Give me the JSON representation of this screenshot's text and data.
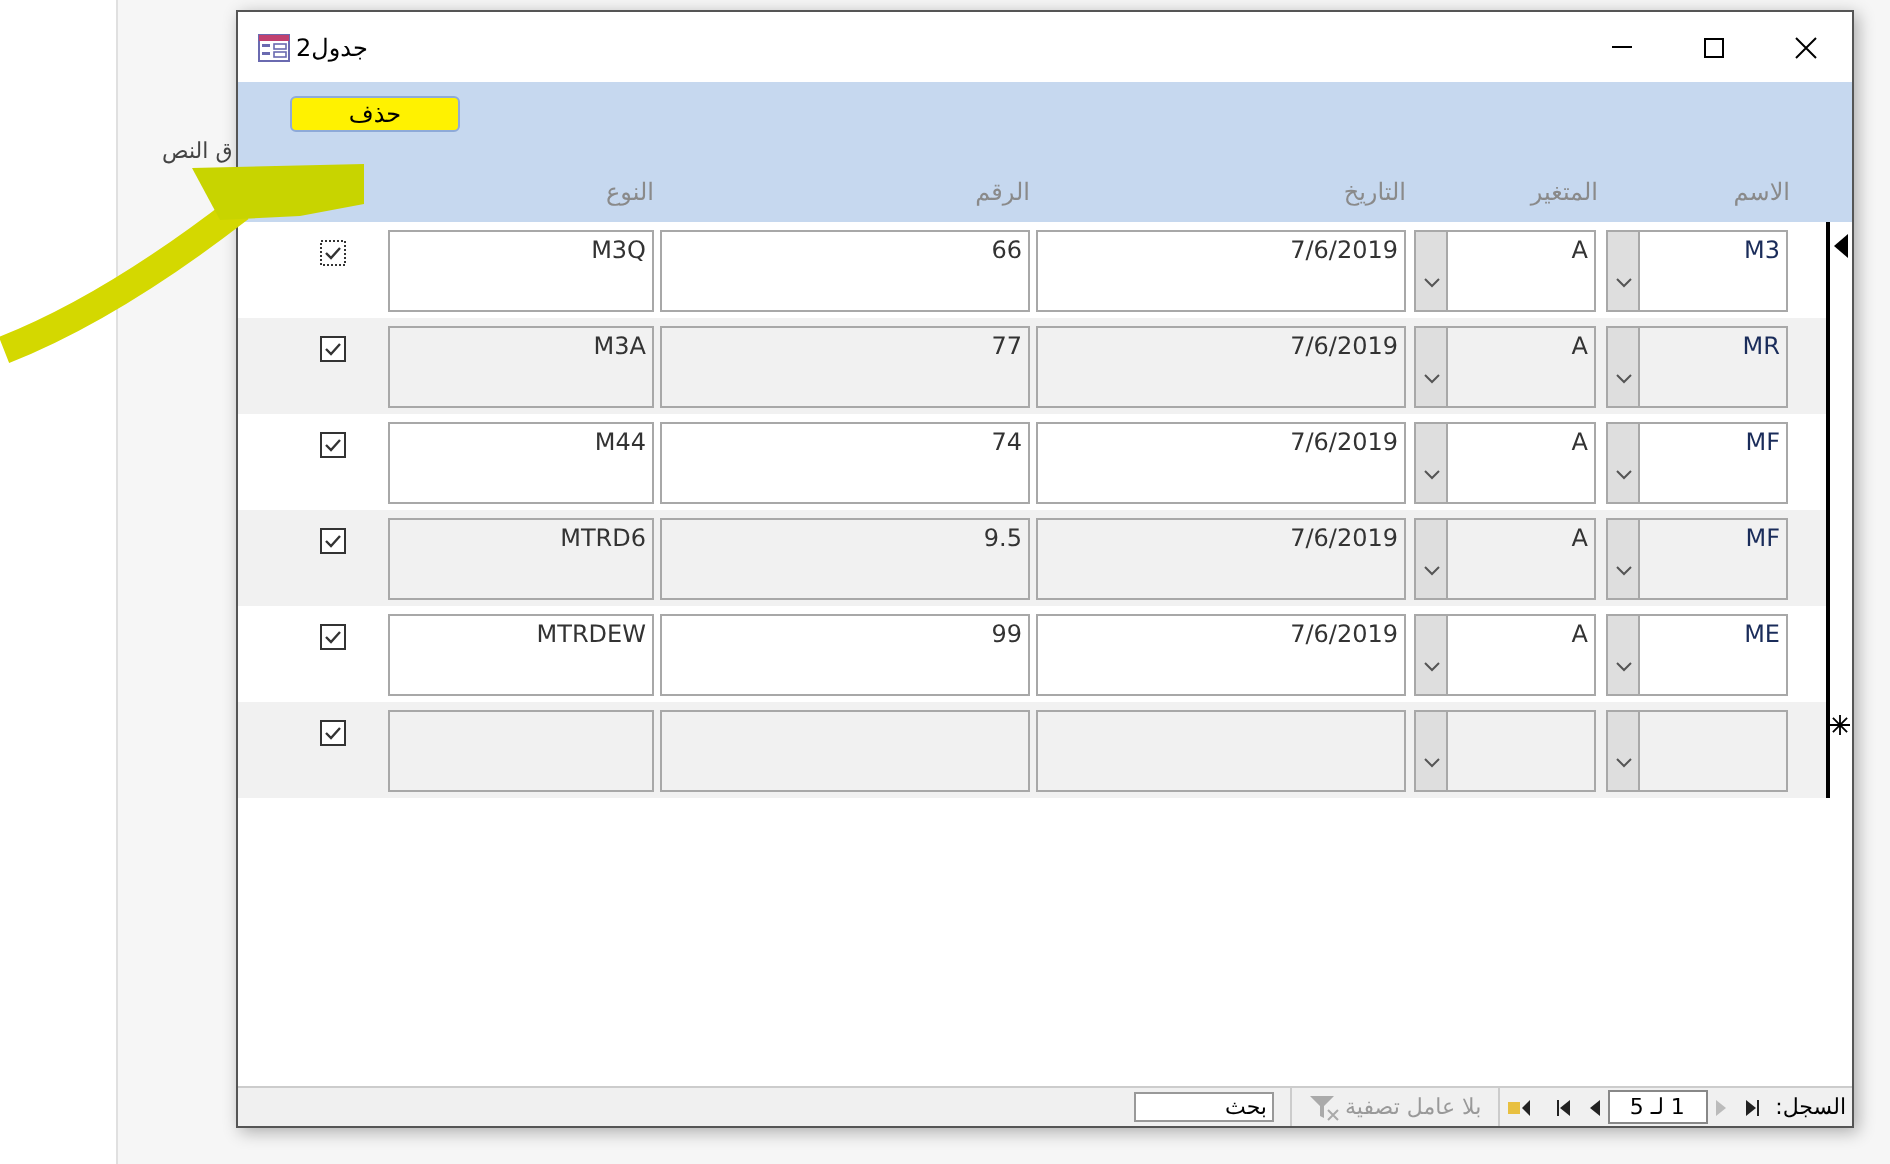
{
  "ribbon": {
    "group_label": "ق النص"
  },
  "window": {
    "title": "جدول2"
  },
  "header": {
    "delete_button": "حذف",
    "columns": [
      "الاسم",
      "المتغير",
      "التاريخ",
      "الرقم",
      "النوع"
    ]
  },
  "rows": [
    {
      "kind": "record",
      "current": true,
      "checked": true,
      "type": "M3Q",
      "number": "66",
      "date": "7/6/2019",
      "variable": "A",
      "name": "M3"
    },
    {
      "kind": "record",
      "current": false,
      "checked": true,
      "type": "M3A",
      "number": "77",
      "date": "7/6/2019",
      "variable": "A",
      "name": "MR"
    },
    {
      "kind": "record",
      "current": false,
      "checked": true,
      "type": "M44",
      "number": "74",
      "date": "7/6/2019",
      "variable": "A",
      "name": "MF"
    },
    {
      "kind": "record",
      "current": false,
      "checked": true,
      "type": "MTRD6",
      "number": "9.5",
      "date": "7/6/2019",
      "variable": "A",
      "name": "MF"
    },
    {
      "kind": "record",
      "current": false,
      "checked": true,
      "type": "MTRDEW",
      "number": "99",
      "date": "7/6/2019",
      "variable": "A",
      "name": "ME"
    },
    {
      "kind": "new",
      "current": false,
      "checked": true
    }
  ],
  "status_bar": {
    "record_label": "السجل:",
    "position": "1 لـ 5",
    "filter": {
      "label": "بلا عامل تصفية",
      "disabled": true
    },
    "search": {
      "placeholder": "بحث"
    }
  }
}
